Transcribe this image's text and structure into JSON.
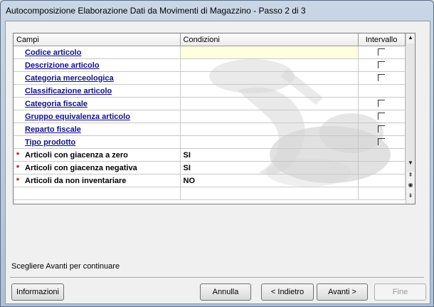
{
  "window": {
    "title": "Autocomposizione Elaborazione Dati da Movimenti di Magazzino - Passo 2 di 3"
  },
  "grid": {
    "headers": {
      "campi": "Campi",
      "condizioni": "Condizioni",
      "intervallo": "Intervallo"
    },
    "rows": [
      {
        "mark": "",
        "field": "Codice articolo",
        "link": true,
        "condition": "",
        "checkbox": true,
        "selected": true
      },
      {
        "mark": "",
        "field": "Descrizione articolo",
        "link": true,
        "condition": "",
        "checkbox": true
      },
      {
        "mark": "",
        "field": "Categoria merceologica",
        "link": true,
        "condition": "",
        "checkbox": true
      },
      {
        "mark": "",
        "field": "Classificazione articolo",
        "link": true,
        "condition": "",
        "checkbox": false
      },
      {
        "mark": "",
        "field": "Categoria fiscale",
        "link": true,
        "condition": "",
        "checkbox": true
      },
      {
        "mark": "",
        "field": "Gruppo equivalenza articolo",
        "link": true,
        "condition": "",
        "checkbox": true
      },
      {
        "mark": "",
        "field": "Reparto fiscale",
        "link": true,
        "condition": "",
        "checkbox": true
      },
      {
        "mark": "",
        "field": "Tipo prodotto",
        "link": true,
        "condition": "",
        "checkbox": true
      },
      {
        "mark": "*",
        "field": "Articoli con giacenza a zero",
        "link": false,
        "condition": "SI",
        "checkbox": false
      },
      {
        "mark": "*",
        "field": "Articoli con giacenza negativa",
        "link": false,
        "condition": "SI",
        "checkbox": false
      },
      {
        "mark": "*",
        "field": "Articoli da non inventariare",
        "link": false,
        "condition": "NO",
        "checkbox": false
      }
    ]
  },
  "status_text": "Scegliere Avanti per continuare",
  "buttons": {
    "informazioni": "Informazioni",
    "annulla": "Annulla",
    "indietro": "< Indietro",
    "avanti": "Avanti >",
    "fine": "Fine"
  }
}
